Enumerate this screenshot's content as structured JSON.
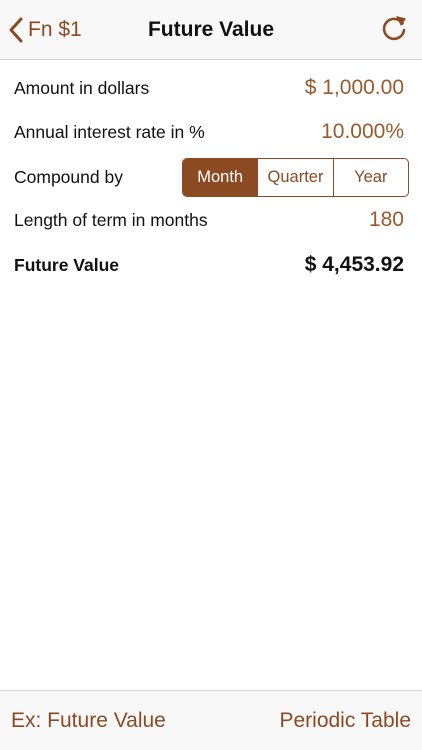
{
  "navbar": {
    "back_label": "Fn $1",
    "title": "Future Value",
    "back_icon": "chevron-left-icon",
    "refresh_icon": "refresh-icon"
  },
  "form": {
    "amount": {
      "label": "Amount in dollars",
      "value": "$ 1,000.00"
    },
    "rate": {
      "label": "Annual interest rate in %",
      "value": "10.000%"
    },
    "compound": {
      "label": "Compound by",
      "options": [
        "Month",
        "Quarter",
        "Year"
      ],
      "selected": "Month"
    },
    "term": {
      "label": "Length of term in months",
      "value": "180"
    },
    "future_value": {
      "label": "Future Value",
      "value": "$ 4,453.92"
    }
  },
  "toolbar": {
    "left_label": "Ex: Future Value",
    "right_label": "Periodic Table"
  },
  "colors": {
    "accent": "#8b4a22",
    "value_text": "#9a5a2c",
    "bar_background": "#f8f8f8"
  }
}
